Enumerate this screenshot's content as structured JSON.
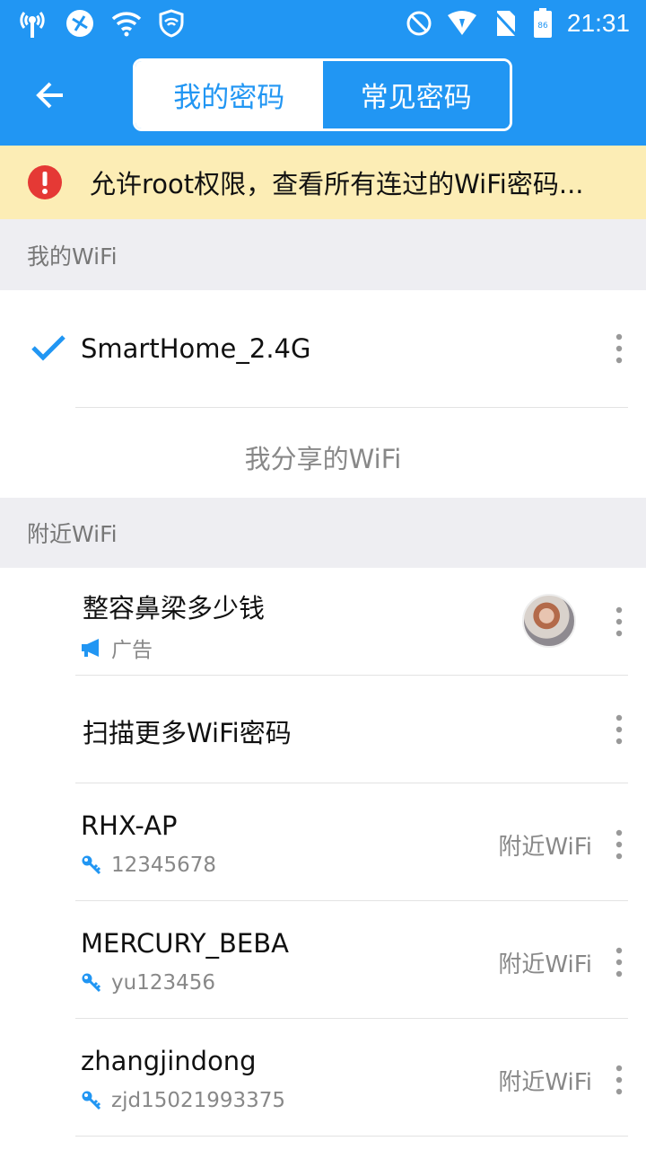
{
  "status_bar": {
    "time": "21:31",
    "battery_level": "86"
  },
  "header": {
    "tabs": [
      {
        "label": "我的密码",
        "active": true
      },
      {
        "label": "常见密码",
        "active": false
      }
    ]
  },
  "banner": {
    "text": "允许root权限，查看所有连过的WiFi密码..."
  },
  "my_wifi": {
    "section_title": "我的WiFi",
    "connected_network": "SmartHome_2.4G",
    "share_link": "我分享的WiFi"
  },
  "nearby": {
    "section_title": "附近WiFi",
    "ad": {
      "title": "整容鼻梁多少钱",
      "tag": "广告"
    },
    "scan_more": "扫描更多WiFi密码",
    "networks": [
      {
        "ssid": "RHX-AP",
        "password": "12345678",
        "label": "附近WiFi"
      },
      {
        "ssid": "MERCURY_BEBA",
        "password": "yu123456",
        "label": "附近WiFi"
      },
      {
        "ssid": "zhangjindong",
        "password": "zjd15021993375",
        "label": "附近WiFi"
      }
    ]
  },
  "colors": {
    "primary": "#2196f3",
    "banner_bg": "#fcedb5",
    "warning_red": "#e53935",
    "section_bg": "#eeeef2"
  }
}
